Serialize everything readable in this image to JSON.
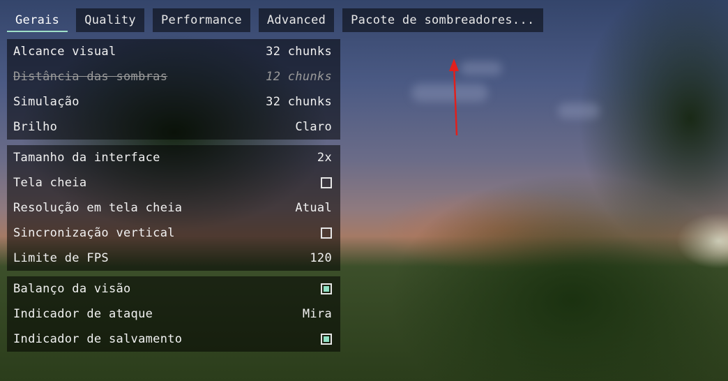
{
  "tabs": [
    {
      "label": "Gerais",
      "active": true
    },
    {
      "label": "Quality",
      "active": false
    },
    {
      "label": "Performance",
      "active": false
    },
    {
      "label": "Advanced",
      "active": false
    },
    {
      "label": "Pacote de sombreadores...",
      "active": false
    }
  ],
  "groups": [
    {
      "rows": [
        {
          "label": "Alcance visual",
          "value": "32 chunks",
          "type": "value"
        },
        {
          "label": "Distância das sombras",
          "value": "12 chunks",
          "type": "value",
          "disabled": true
        },
        {
          "label": "Simulação",
          "value": "32 chunks",
          "type": "value"
        },
        {
          "label": "Brilho",
          "value": "Claro",
          "type": "value"
        }
      ]
    },
    {
      "rows": [
        {
          "label": "Tamanho da interface",
          "value": "2x",
          "type": "value"
        },
        {
          "label": "Tela cheia",
          "checked": false,
          "type": "checkbox"
        },
        {
          "label": "Resolução em tela cheia",
          "value": "Atual",
          "type": "value"
        },
        {
          "label": "Sincronização vertical",
          "checked": false,
          "type": "checkbox"
        },
        {
          "label": "Limite de FPS",
          "value": "120",
          "type": "value"
        }
      ]
    },
    {
      "rows": [
        {
          "label": "Balanço da visão",
          "checked": true,
          "type": "checkbox"
        },
        {
          "label": "Indicador de ataque",
          "value": "Mira",
          "type": "value"
        },
        {
          "label": "Indicador de salvamento",
          "checked": true,
          "type": "checkbox"
        }
      ]
    }
  ],
  "colors": {
    "accent": "#9fe0c8",
    "checkbox_fill": "#8fe0c4",
    "annotation_arrow": "#e0201c"
  }
}
